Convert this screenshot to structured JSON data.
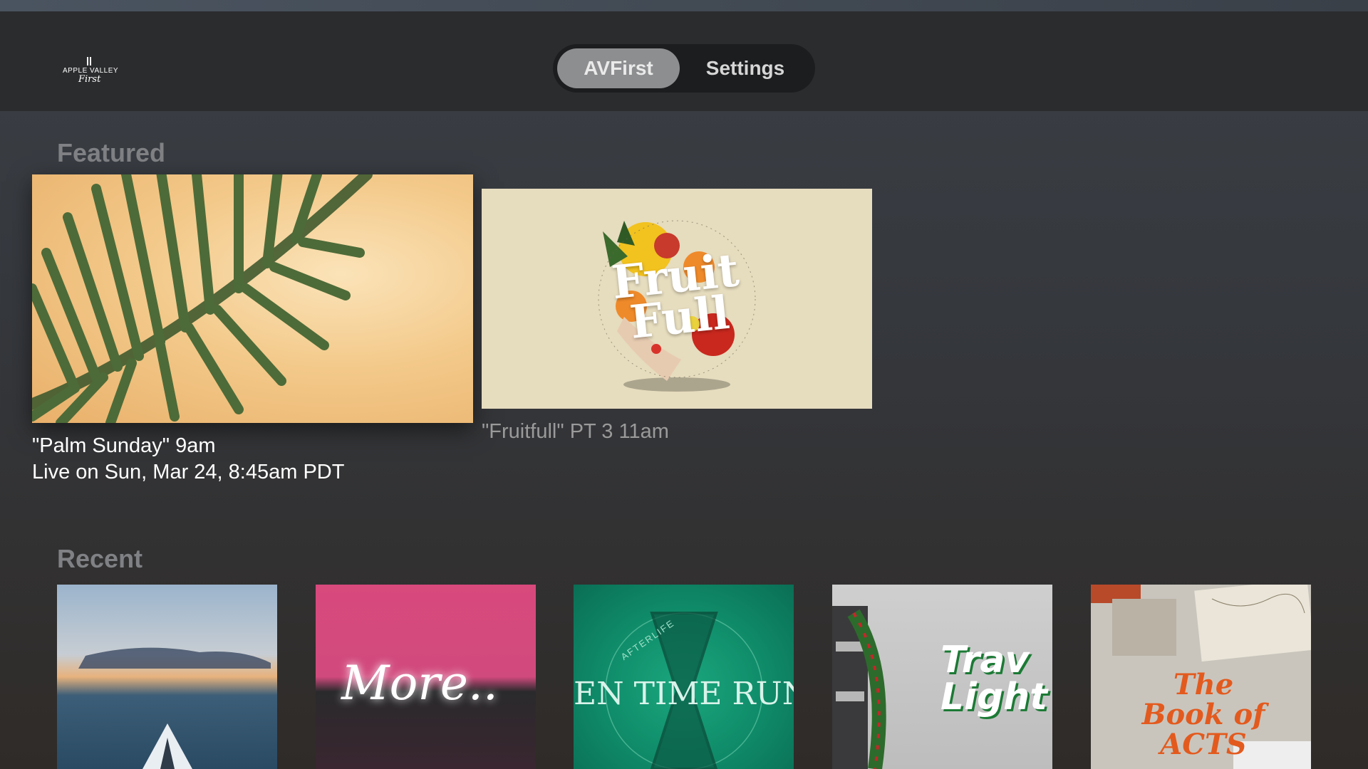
{
  "header": {
    "logo_line1": "APPLE VALLEY",
    "logo_line2": "First",
    "tabs": [
      {
        "label": "AVFirst",
        "selected": true
      },
      {
        "label": "Settings",
        "selected": false
      }
    ]
  },
  "featured": {
    "title": "Featured",
    "items": [
      {
        "line1": "\"Palm Sunday\"  9am",
        "line2": "Live on Sun, Mar 24, 8:45am PDT"
      },
      {
        "line1": "\"Fruitfull\" PT 3 11am",
        "art_title": "Fruit Full"
      }
    ]
  },
  "recent": {
    "title": "Recent",
    "items": [
      {
        "art_text": ""
      },
      {
        "art_text": "More.."
      },
      {
        "art_text": "EN TIME RUNS O",
        "art_subtext": "AFTERLIFE"
      },
      {
        "art_text": "Trav Light"
      },
      {
        "art_text": "The Book of ACTS"
      }
    ]
  }
}
